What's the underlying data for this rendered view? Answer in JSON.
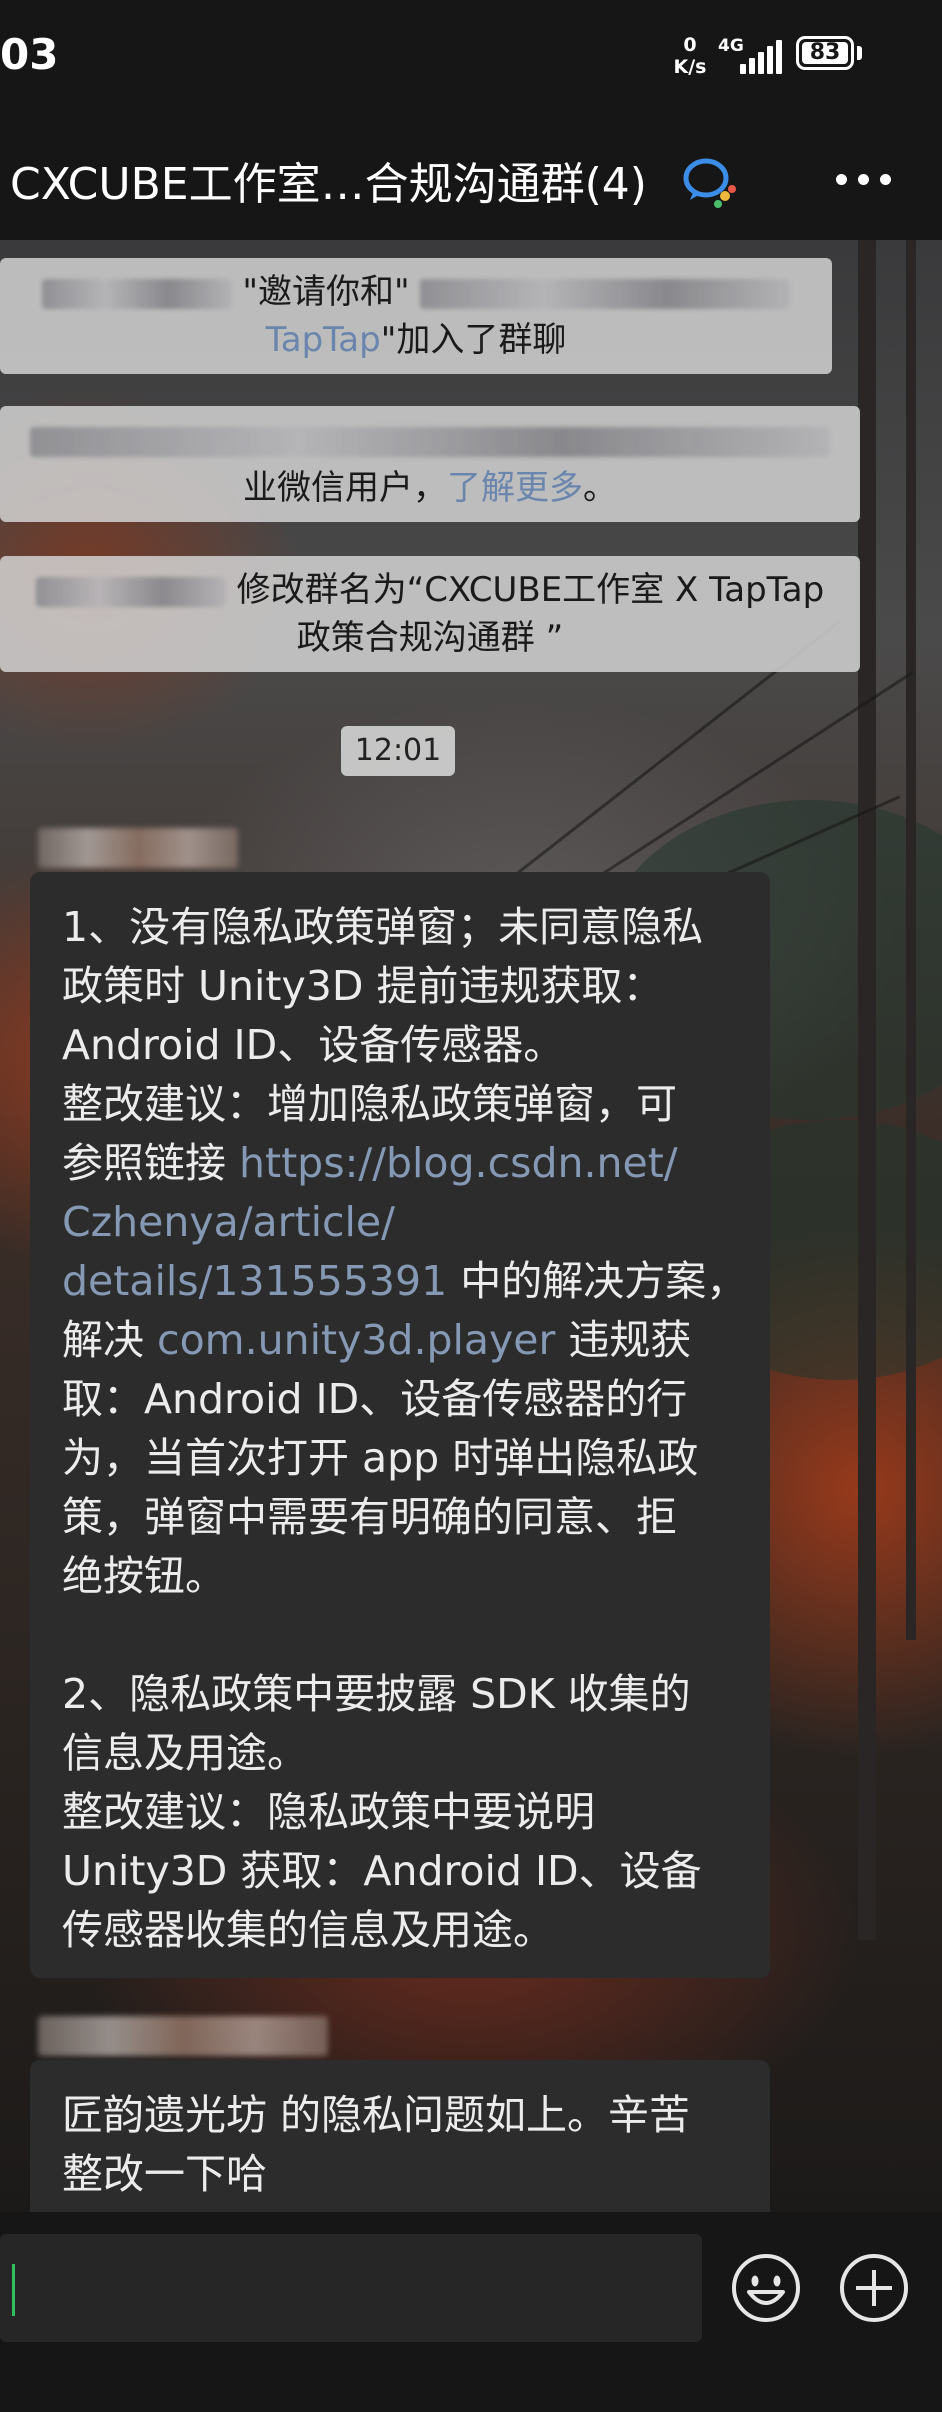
{
  "status_bar": {
    "time": "03",
    "net_speed_value": "0",
    "net_speed_unit": "K/s",
    "signal_label": "4G",
    "battery": "83"
  },
  "header": {
    "title": "CXCUBE工作室…合规沟通群(4)"
  },
  "messages": {
    "notice1": {
      "line1": "\"邀请你和\"",
      "line2_link": "TapTap",
      "line2_text": "\"加入了群聊"
    },
    "notice2": {
      "line2_text": "业微信用户，",
      "line2_link": "了解更多",
      "line2_end": "。"
    },
    "notice3": {
      "line1": "修改群名为“CXCUBE工作室 X TapTap",
      "line2": "政策合规沟通群 ”"
    },
    "timestamp": "12:01",
    "bubble1": {
      "line1": "1、没有隐私政策弹窗；未同意隐私",
      "line2": "政策时 Unity3D 提前违规获取：",
      "line3": "Android ID、设备传感器。",
      "line4": "整改建议：增加隐私政策弹窗，可",
      "line5_text": "参照链接 ",
      "line5_link": "https://blog.csdn.net/",
      "line6_link": "Czhenya/article/",
      "line7_link": "details/131555391",
      "line7_text": " 中的解决方案，",
      "line8_text": "解决 ",
      "line8_link": "com.unity3d.player",
      "line8_end": " 违规获",
      "line9": "取：Android ID、设备传感器的行",
      "line10": "为，当首次打开 app 时弹出隐私政",
      "line11": "策，弹窗中需要有明确的同意、拒",
      "line12": "绝按钮。",
      "line13": "2、隐私政策中要披露 SDK 收集的",
      "line14": "信息及用途。",
      "line15": "整改建议：隐私政策中要说明",
      "line16": "Unity3D 获取：Android ID、设备",
      "line17": "传感器收集的信息及用途。"
    },
    "bubble2": {
      "line1": "匠韵遗光坊 的隐私问题如上。辛苦",
      "line2": "整改一下哈"
    }
  },
  "input_bar": {
    "emoji_icon": "smiley-face-icon",
    "plus_icon": "plus-circle-icon"
  },
  "colors": {
    "link": "#8599b5",
    "cursor": "#2fc15f",
    "bubble": "#2c2c2c",
    "notice": "#d2d2d2"
  }
}
